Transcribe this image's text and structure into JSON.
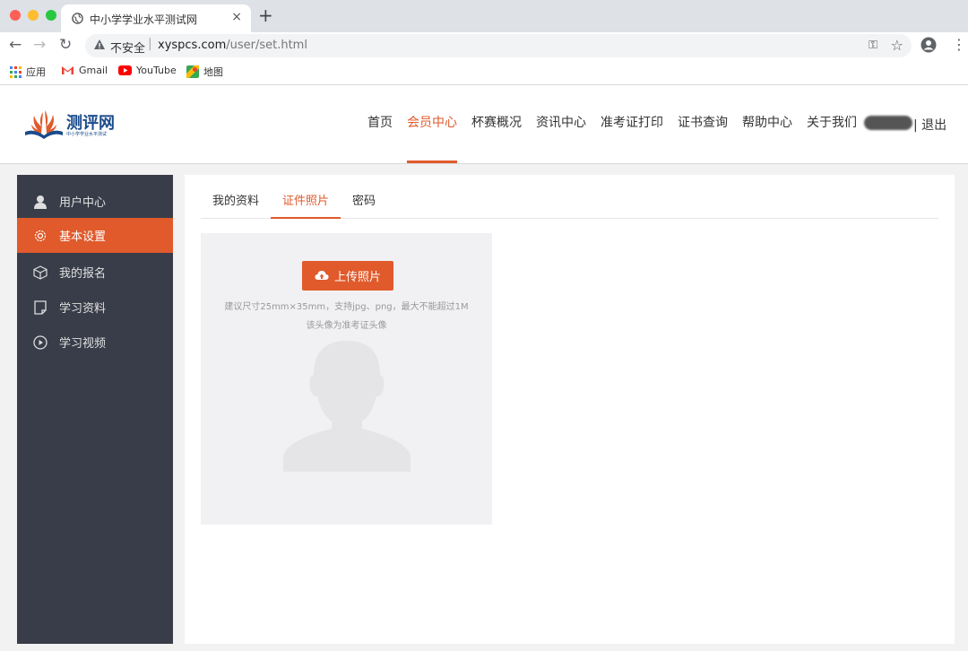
{
  "browser": {
    "tab_title": "中小学学业水平测试网",
    "tab_close": "×",
    "new_tab": "+",
    "security_label": "不安全",
    "url_host": "xyspcs.com",
    "url_path": "/user/set.html",
    "bookmarks": [
      {
        "label": "应用",
        "icon": "apps-grid-icon"
      },
      {
        "label": "Gmail",
        "icon": "gmail-icon"
      },
      {
        "label": "YouTube",
        "icon": "youtube-icon"
      },
      {
        "label": "地图",
        "icon": "maps-icon"
      }
    ]
  },
  "site": {
    "logo_text": "测评网",
    "logo_subtext": "中小学学业水平测试",
    "nav": [
      {
        "label": "首页",
        "active": false
      },
      {
        "label": "会员中心",
        "active": true
      },
      {
        "label": "杯赛概况",
        "active": false
      },
      {
        "label": "资讯中心",
        "active": false
      },
      {
        "label": "准考证打印",
        "active": false
      },
      {
        "label": "证书查询",
        "active": false
      },
      {
        "label": "帮助中心",
        "active": false
      },
      {
        "label": "关于我们",
        "active": false
      }
    ],
    "logout": "| 退出",
    "accent_color": "#e05a2b"
  },
  "sidebar": {
    "items": [
      {
        "label": "用户中心",
        "icon": "user-icon",
        "active": false
      },
      {
        "label": "基本设置",
        "icon": "gear-icon",
        "active": true
      },
      {
        "label": "我的报名",
        "icon": "box-icon",
        "active": false
      },
      {
        "label": "学习资料",
        "icon": "document-icon",
        "active": false
      },
      {
        "label": "学习视频",
        "icon": "play-circle-icon",
        "active": false
      }
    ]
  },
  "content": {
    "tabs": [
      {
        "label": "我的资料",
        "active": false
      },
      {
        "label": "证件照片",
        "active": true
      },
      {
        "label": "密码",
        "active": false
      }
    ],
    "upload_label": "上传照片",
    "hint_size": "建议尺寸25mm×35mm，支持jpg、png，最大不能超过1M",
    "hint_usage": "该头像为准考证头像"
  }
}
